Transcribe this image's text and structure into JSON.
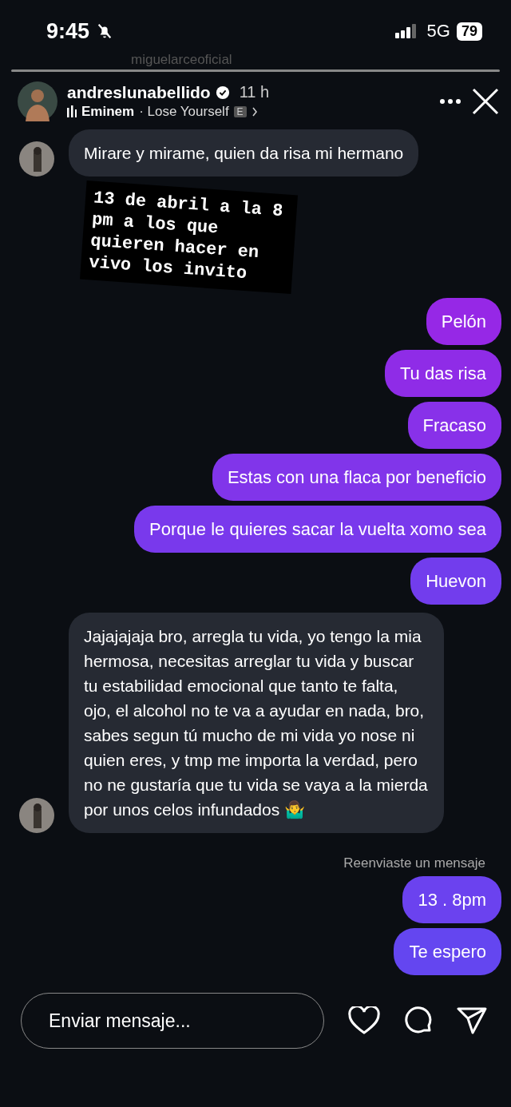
{
  "status_bar": {
    "time": "9:45",
    "network": "5G",
    "battery": "79"
  },
  "story": {
    "username": "miguelarceoficial"
  },
  "header": {
    "username": "andreslunabellido",
    "verified": true,
    "time": "11 h",
    "music_artist": "Eminem",
    "music_song": "· Lose Yourself",
    "explicit": "E"
  },
  "messages": [
    {
      "kind": "received",
      "avatar": true,
      "text": "Mirare y mirame, quien da risa mi hermano"
    },
    {
      "kind": "sticker",
      "text": "13 de abril a la 8 pm a los que quieren hacer en vivo los invito"
    },
    {
      "kind": "sent",
      "text": "Pelón"
    },
    {
      "kind": "sent",
      "text": "Tu das risa"
    },
    {
      "kind": "sent",
      "text": "Fracaso"
    },
    {
      "kind": "sent",
      "text": "Estas con una flaca por beneficio"
    },
    {
      "kind": "sent",
      "text": "Porque le quieres sacar la vuelta xomo sea"
    },
    {
      "kind": "sent",
      "text": "Huevon"
    },
    {
      "kind": "received",
      "avatar": true,
      "text": "Jajajajaja bro, arregla tu vida, yo tengo la mia hermosa, necesitas arreglar tu vida y buscar tu estabilidad emocional que tanto te falta, ojo, el alcohol no te va a ayudar en nada, bro, sabes segun tú mucho de mi vida  yo nose ni quien eres, y tmp me importa la verdad, pero no ne gustaría que tu vida se vaya a la mierda por unos celos infundados 🤷‍♂️"
    },
    {
      "kind": "notice",
      "text": "Reenviaste un mensaje"
    },
    {
      "kind": "sent",
      "text": "13 . 8pm"
    },
    {
      "kind": "sent",
      "text": "Te espero"
    }
  ],
  "composer": {
    "placeholder": "Enviar mensaje..."
  }
}
